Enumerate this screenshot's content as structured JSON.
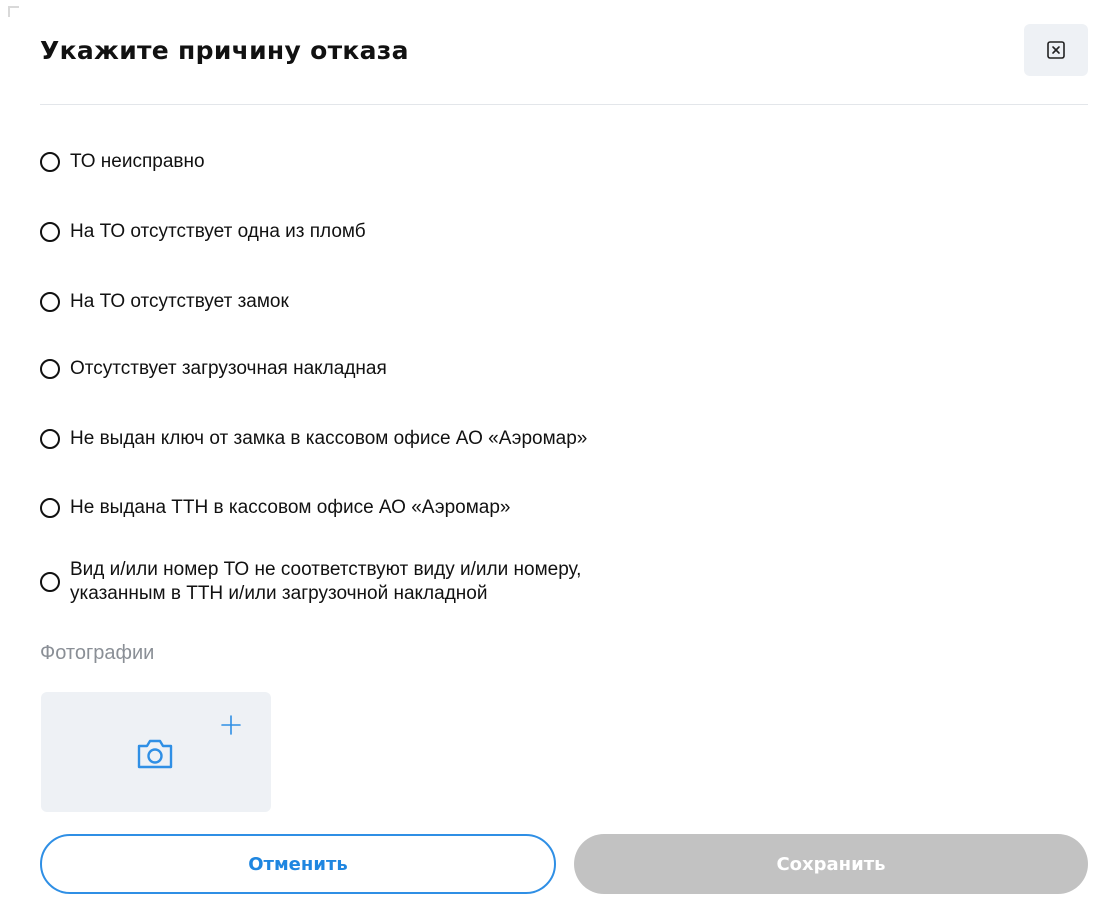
{
  "dialog": {
    "title": "Укажите причину отказа",
    "close_icon": "close-icon"
  },
  "reasons": [
    {
      "label": "ТО неисправно",
      "selected": false
    },
    {
      "label": "На ТО отсутствует одна из пломб",
      "selected": false
    },
    {
      "label": "На ТО отсутствует замок",
      "selected": false
    },
    {
      "label": "Отсутствует загрузочная накладная",
      "selected": false
    },
    {
      "label": "Не выдан ключ от замка в кассовом офисе АО «Аэромар»",
      "selected": false
    },
    {
      "label": "Не выдана ТТН в кассовом офисе АО «Аэромар»",
      "selected": false
    },
    {
      "label": "Вид и/или номер ТО не соответствуют виду и/или номеру,\n указанным в ТТН и/или загрузочной накладной",
      "selected": false
    }
  ],
  "photos": {
    "label": "Фотографии",
    "add_icon": "camera-icon",
    "plus_icon": "plus-icon"
  },
  "actions": {
    "cancel_label": "Отменить",
    "save_label": "Сохранить",
    "save_enabled": false
  },
  "colors": {
    "accent": "#1f86e0",
    "disabled_button": "#c2c2c2",
    "tile_background": "#eef1f5",
    "muted_text": "#8a8f96"
  }
}
